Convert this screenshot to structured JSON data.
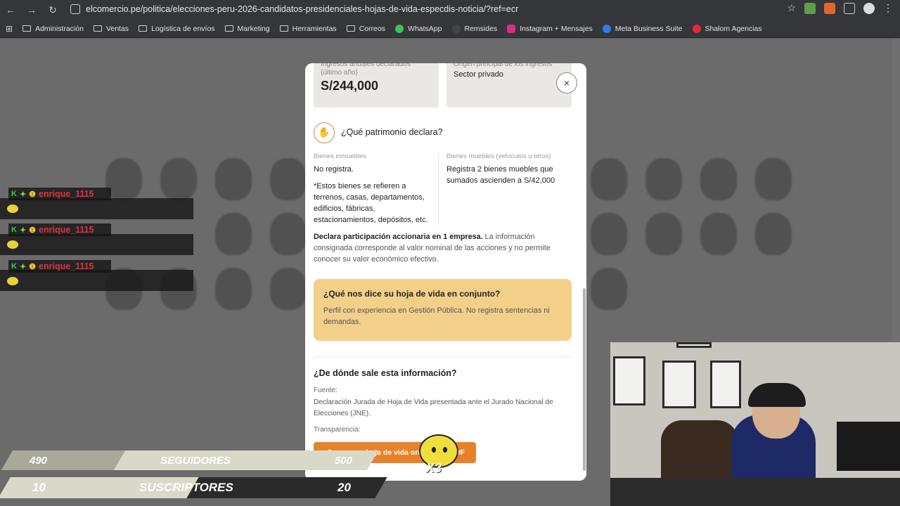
{
  "browser": {
    "url": "elcomercio.pe/politica/elecciones-peru-2026-candidatos-presidenciales-hojas-de-vida-especdis-noticia/?ref=ecr",
    "bookmarks": [
      "Administración",
      "Ventas",
      "Logística de envíos",
      "Marketing",
      "Herramientas",
      "Correos",
      "WhatsApp",
      "Remsides",
      "Instagram + Mensajes",
      "Meta Business Suite",
      "Shalom Agencias"
    ]
  },
  "chat": {
    "messages": [
      {
        "user": "enrique_1115"
      },
      {
        "user": "enrique_1115"
      },
      {
        "user": "enrique_1115"
      }
    ]
  },
  "modal": {
    "income_label": "Ingresos anuales declarados (último año)",
    "income_value": "S/244,000",
    "origin_label": "Origen principal de los ingresos",
    "origin_value": "Sector privado",
    "patrimony_title": "¿Qué patrimonio declara?",
    "real_estate_label": "Bienes inmuebles",
    "real_estate_value": "No registra.",
    "real_estate_note": "*Estos bienes se refieren a terrenos, casas, departamentos, edificios, fábricas, estacionamientos, depósitos, etc.",
    "movable_label": "Bienes muebles (vehículos u otros)",
    "movable_value": "Registra 2 bienes muebles que sumados ascienden a S/42,000",
    "shares_bold": "Declara participación accionaria en 1 empresa.",
    "shares_rest": " La información consignada corresponde al valor nominal de las acciones y no permite conocer su valor económico efectivo.",
    "summary_title": "¿Qué nos dice su hoja de vida en conjunto?",
    "summary_text": "Perfil con experiencia en Gestión Pública. No registra sentencias ni demandas.",
    "source_title": "¿De dónde sale esta información?",
    "source_label": "Fuente:",
    "source_text": "Declaración Jurada de Hoja de Vida presentada ante el Jurado Nacional de Elecciones (JNE).",
    "transparency_label": "Transparencia:",
    "pdf_button": "Descargar hoja de vida original en PDF",
    "close_icon": "×"
  },
  "counters": {
    "followers_current": "490",
    "followers_label": "SEGUIDORES",
    "followers_goal": "500",
    "subs_current": "10",
    "subs_label": "SUSCRIPTORES",
    "subs_goal": "20"
  },
  "mascot_multiplier": "X3",
  "colors": {
    "accent_orange": "#e8822a",
    "summary_bg": "#f3d08a",
    "chat_user": "#e0303a",
    "counter_bar": "#d9d9c9"
  }
}
